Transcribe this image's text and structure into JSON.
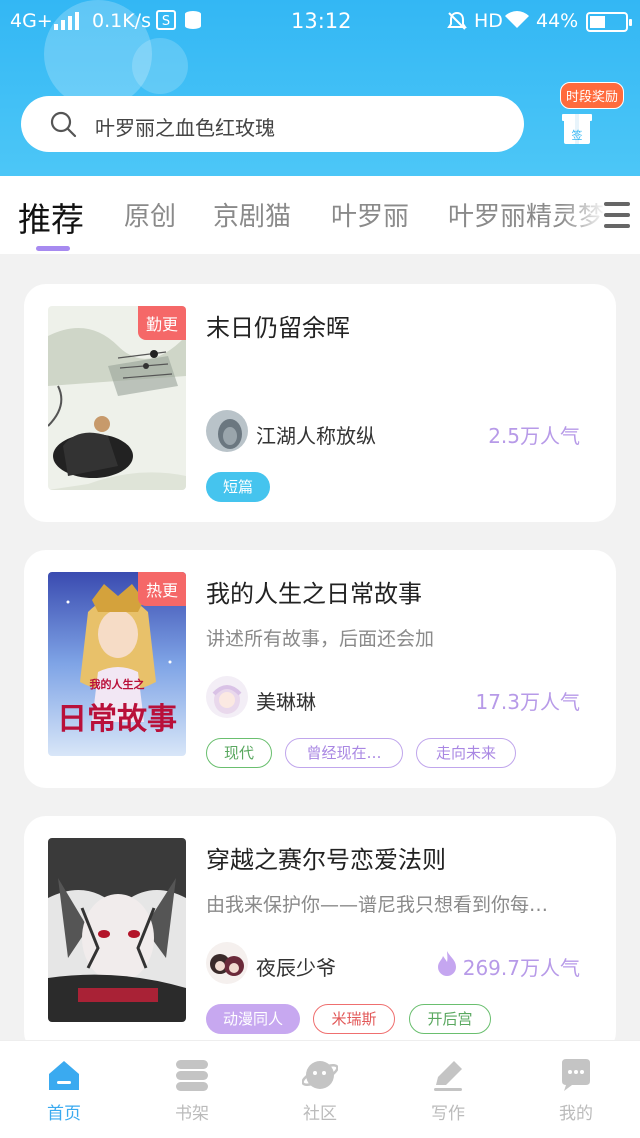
{
  "status_bar": {
    "network": "4G+",
    "speed": "0.1K/s",
    "time": "13:12",
    "hd": "HD",
    "battery": "44%",
    "battery_level": 0.44
  },
  "search": {
    "placeholder": "叶罗丽之血色红玫瑰"
  },
  "reward": {
    "badge": "时段奖励",
    "gift_label": "签"
  },
  "tabs": [
    {
      "label": "推荐",
      "active": true
    },
    {
      "label": "原创",
      "active": false
    },
    {
      "label": "京剧猫",
      "active": false
    },
    {
      "label": "叶罗丽",
      "active": false
    },
    {
      "label": "叶罗丽精灵梦",
      "active": false
    }
  ],
  "cards": [
    {
      "title": "末日仍留余晖",
      "description": "",
      "cover_tag": "勤更",
      "author": "江湖人称放纵",
      "popularity": "2.5万人气",
      "tags": [
        "短篇"
      ]
    },
    {
      "title": "我的人生之日常故事",
      "description": "讲述所有故事，后面还会加",
      "cover_tag": "热更",
      "cover_text_top": "我的人生之",
      "cover_text_main": "日常故事",
      "author": "美琳琳",
      "popularity": "17.3万人气",
      "tags": [
        "现代",
        "曾经现在…",
        "走向未来"
      ]
    },
    {
      "title": "穿越之赛尔号恋爱法则",
      "description": "由我来保护你——谱尼我只想看到你每…",
      "cover_tag": "",
      "author": "夜辰少爷",
      "popularity": "269.7万人气",
      "tags": [
        "动漫同人",
        "米瑞斯",
        "开后宫"
      ]
    }
  ],
  "bottom_nav": [
    {
      "label": "首页",
      "icon": "home-icon",
      "active": true
    },
    {
      "label": "书架",
      "icon": "bookshelf-icon",
      "active": false
    },
    {
      "label": "社区",
      "icon": "community-icon",
      "active": false
    },
    {
      "label": "写作",
      "icon": "write-icon",
      "active": false
    },
    {
      "label": "我的",
      "icon": "profile-icon",
      "active": false
    }
  ],
  "colors": {
    "header": "#33b7f4",
    "accent": "#a78af0",
    "nav_active": "#3aaaf0",
    "popularity": "#b79ae8"
  }
}
